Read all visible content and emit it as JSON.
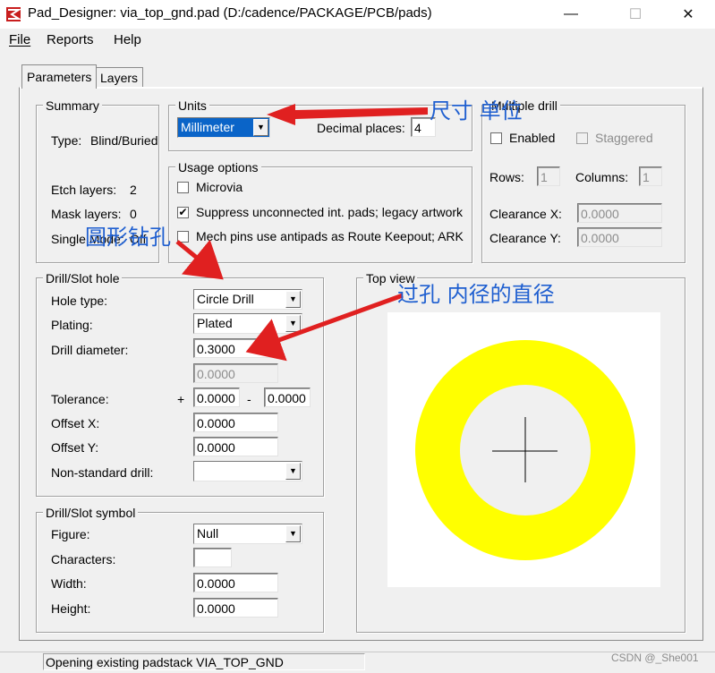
{
  "window": {
    "title": "Pad_Designer: via_top_gnd.pad (D:/cadence/PACKAGE/PCB/pads)",
    "minimize": "—",
    "maximize": "☐",
    "close": "✕"
  },
  "menu": [
    {
      "label": "File",
      "underline": "F"
    },
    {
      "label": "Reports",
      "underline": "R"
    },
    {
      "label": "Help",
      "underline": "H"
    }
  ],
  "tabs": [
    "Parameters",
    "Layers"
  ],
  "summary": {
    "title": "Summary",
    "type_label": "Type:",
    "type_value": "Blind/Buried",
    "etch_label": "Etch layers:",
    "etch_value": "2",
    "mask_label": "Mask layers:",
    "mask_value": "0",
    "single_label": "Single Mode:",
    "single_value": "Off"
  },
  "units": {
    "title": "Units",
    "selected": "Millimeter",
    "decimal_label": "Decimal places:",
    "decimal_value": "4"
  },
  "usage": {
    "title": "Usage options",
    "microvia": {
      "label": "Microvia",
      "checked": false
    },
    "suppress": {
      "label": "Suppress unconnected int. pads; legacy artwork",
      "checked": true
    },
    "mech": {
      "label": "Mech pins use antipads as Route Keepout; ARK",
      "checked": false
    }
  },
  "multiple_drill": {
    "title": "Multiple drill",
    "enabled_label": "Enabled",
    "staggered_label": "Staggered",
    "rows_label": "Rows:",
    "rows_value": "1",
    "columns_label": "Columns:",
    "columns_value": "1",
    "clearance_x_label": "Clearance X:",
    "clearance_x_value": "0.0000",
    "clearance_y_label": "Clearance Y:",
    "clearance_y_value": "0.0000"
  },
  "drill": {
    "title": "Drill/Slot hole",
    "hole_type_label": "Hole type:",
    "hole_type_value": "Circle Drill",
    "plating_label": "Plating:",
    "plating_value": "Plated",
    "diameter_label": "Drill diameter:",
    "diameter_value": "0.3000",
    "diameter_secondary": "0.0000",
    "tolerance_label": "Tolerance:",
    "tol_plus": "+",
    "tol_plus_value": "0.0000",
    "tol_minus": "-",
    "tol_minus_value": "0.0000",
    "offset_x_label": "Offset X:",
    "offset_x_value": "0.0000",
    "offset_y_label": "Offset Y:",
    "offset_y_value": "0.0000",
    "nonstd_label": "Non-standard drill:",
    "nonstd_value": ""
  },
  "symbol": {
    "title": "Drill/Slot symbol",
    "figure_label": "Figure:",
    "figure_value": "Null",
    "characters_label": "Characters:",
    "characters_value": "",
    "width_label": "Width:",
    "width_value": "0.0000",
    "height_label": "Height:",
    "height_value": "0.0000"
  },
  "top_view": {
    "title": "Top view",
    "pad_color": "#ffff00",
    "hole_color": "#f0f0f0"
  },
  "status": {
    "message": "Opening existing padstack VIA_TOP_GND"
  },
  "annotations": {
    "units_note": "尺寸 单位",
    "drill_note": "圆形钻孔",
    "diameter_note": "过孔 内径的直径",
    "color": "#1f5fd0",
    "arrow_color": "#e02020"
  },
  "watermark": "CSDN @_She001"
}
